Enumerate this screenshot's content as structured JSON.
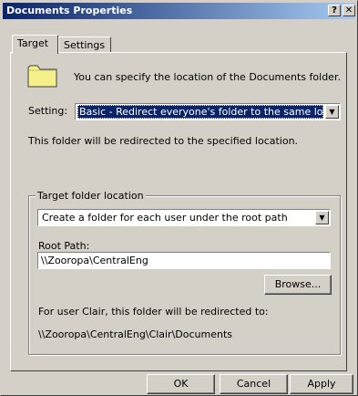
{
  "window": {
    "title": "Documents Properties",
    "help_label": "?",
    "close_label": "✕"
  },
  "tabs": [
    {
      "label": "Target"
    },
    {
      "label": "Settings"
    }
  ],
  "main": {
    "icon": "folder-icon",
    "intro": "You can specify the location of the Documents folder.",
    "setting_label": "Setting:",
    "setting_value": "Basic - Redirect everyone's folder to the same location",
    "redirect_note": "This folder will be redirected to the specified location."
  },
  "target_group": {
    "title": "Target folder location",
    "target_value": "Create a folder for each user under the root path",
    "root_path_label": "Root Path:",
    "root_path_value": "\\\\Zooropa\\CentralEng",
    "browse_label": "Browse...",
    "redirect_to_label": "For user Clair, this folder will be redirected to:",
    "redirect_to_path": "\\\\Zooropa\\CentralEng\\Clair\\Documents"
  },
  "buttons": {
    "ok": "OK",
    "cancel": "Cancel",
    "apply": "Apply"
  },
  "colors": {
    "titlebar_start": "#0a246a",
    "titlebar_end": "#a6caf0",
    "face": "#d4d0c8",
    "selection": "#0a246a",
    "folder": "#f6f08a"
  }
}
